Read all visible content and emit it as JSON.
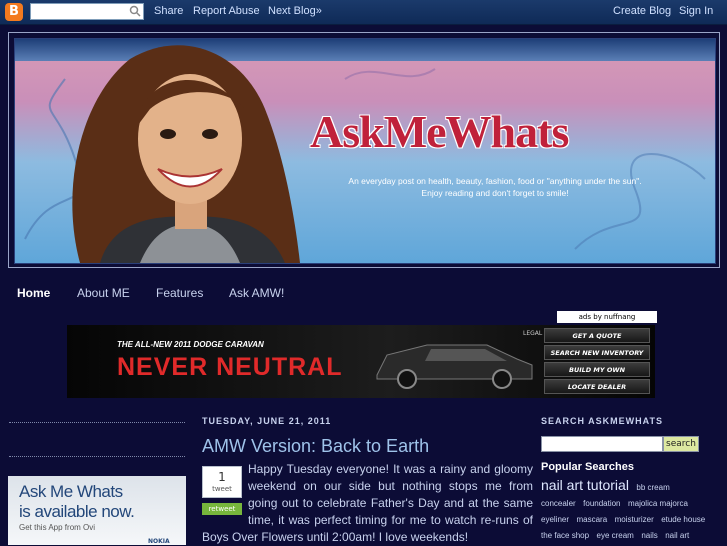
{
  "navbar": {
    "logo": "B",
    "links": [
      "Share",
      "Report Abuse",
      "Next Blog»"
    ],
    "right_links": [
      "Create Blog",
      "Sign In"
    ]
  },
  "header": {
    "title": "AskMeWhats",
    "tagline_line1": "An everyday post on health, beauty, fashion, food or \"anything under the sun\".",
    "tagline_line2": "Enjoy reading and don't forget to smile!"
  },
  "main_nav": [
    "Home",
    "About ME",
    "Features",
    "Ask AMW!"
  ],
  "ad": {
    "tag": "ads by nuffnang",
    "headline": "THE ALL-NEW 2011 DODGE CARAVAN",
    "slogan": "NEVER NEUTRAL",
    "legal": "LEGAL",
    "buttons": [
      "GET A QUOTE",
      "SEARCH NEW INVENTORY",
      "BUILD MY OWN",
      "LOCATE DEALER"
    ]
  },
  "left_sidebar": {
    "app_title_line1": "Ask Me Whats",
    "app_title_line2": "is available now.",
    "app_subtitle": "Get this App from Ovi",
    "brand": "NOKIA"
  },
  "post": {
    "date": "TUESDAY, JUNE 21, 2011",
    "title": "AMW Version: Back to Earth",
    "tweet_count": "1",
    "tweet_label": "tweet",
    "retweet_label": "retweet",
    "body": "Happy Tuesday everyone!  It was a rainy and gloomy weekend on our side but nothing stops me from going out to celebrate Father's Day and at the same time, it was perfect timing for me to watch re-runs of Boys Over Flowers until 2:00am!  I love weekends!"
  },
  "right_sidebar": {
    "search_heading": "SEARCH ASKMEWHATS",
    "search_button": "search",
    "popular_heading": "Popular Searches",
    "tags": [
      {
        "text": "nail art tutorial",
        "size": "big"
      },
      {
        "text": "bb cream",
        "size": "small"
      },
      {
        "text": "concealer",
        "size": "small"
      },
      {
        "text": "foundation",
        "size": "small"
      },
      {
        "text": "majolica majorca",
        "size": "small"
      },
      {
        "text": "eyeliner",
        "size": "small"
      },
      {
        "text": "mascara",
        "size": "small"
      },
      {
        "text": "moisturizer",
        "size": "small"
      },
      {
        "text": "etude house",
        "size": "small"
      },
      {
        "text": "the face shop",
        "size": "small"
      },
      {
        "text": "eye cream",
        "size": "small"
      },
      {
        "text": "nails",
        "size": "small"
      },
      {
        "text": "nail art",
        "size": "small"
      }
    ]
  },
  "colors": {
    "page_bg": "#0c0c36",
    "title_red": "#c0213a",
    "link_blue": "#9fc3ea",
    "retweet_green": "#77b63c"
  }
}
